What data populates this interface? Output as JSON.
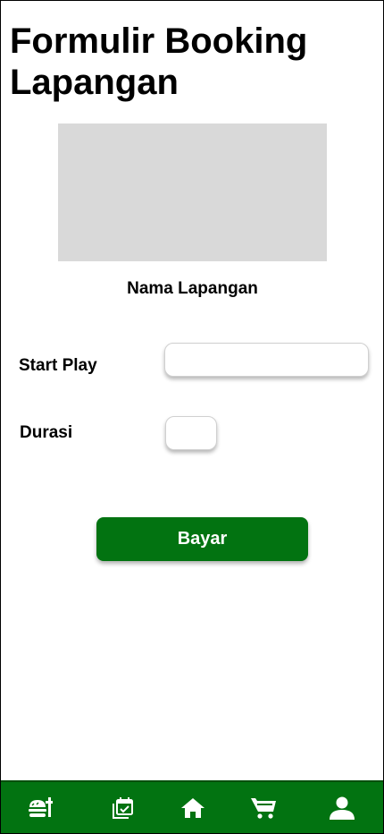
{
  "page": {
    "title": "Formulir Booking Lapangan",
    "venue_name": "Nama Lapangan"
  },
  "form": {
    "start_play_label": "Start Play",
    "start_play_value": "",
    "durasi_label": "Durasi",
    "durasi_value": "",
    "submit_label": "Bayar"
  },
  "bottom_nav": {
    "items": [
      {
        "icon": "food-icon"
      },
      {
        "icon": "calendar-check-icon"
      },
      {
        "icon": "home-icon"
      },
      {
        "icon": "cart-icon"
      },
      {
        "icon": "user-icon"
      }
    ]
  },
  "colors": {
    "accent": "#027311",
    "placeholder_gray": "#d9d9d9"
  }
}
